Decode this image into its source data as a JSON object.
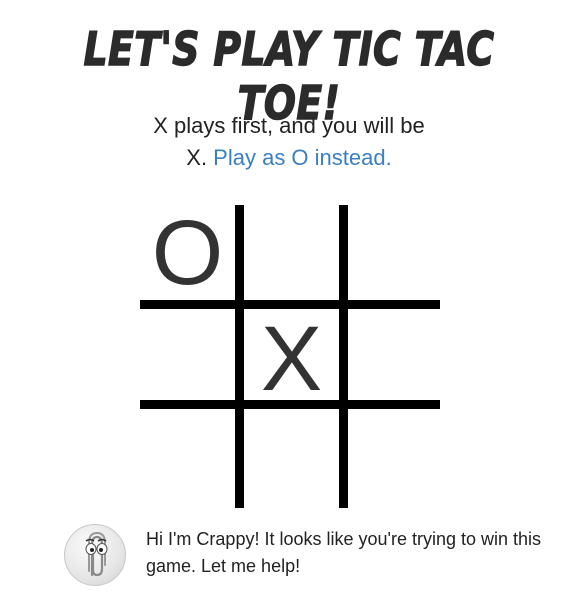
{
  "header": {
    "title": "LET'S PLAY TIC TAC TOE!"
  },
  "intro": {
    "line1": "X plays first, and you will be",
    "line2_prefix": "X. ",
    "switch_link": "Play as O instead."
  },
  "board": {
    "cells": [
      "O",
      "",
      "",
      "",
      "X",
      "",
      "",
      "",
      ""
    ]
  },
  "assistant": {
    "icon": "paperclip-icon",
    "message": "Hi I'm Crappy! It looks like you're trying to win this game. Let me help!"
  },
  "colors": {
    "link": "#3a7fc1",
    "grid": "#000000",
    "text": "#222222"
  }
}
